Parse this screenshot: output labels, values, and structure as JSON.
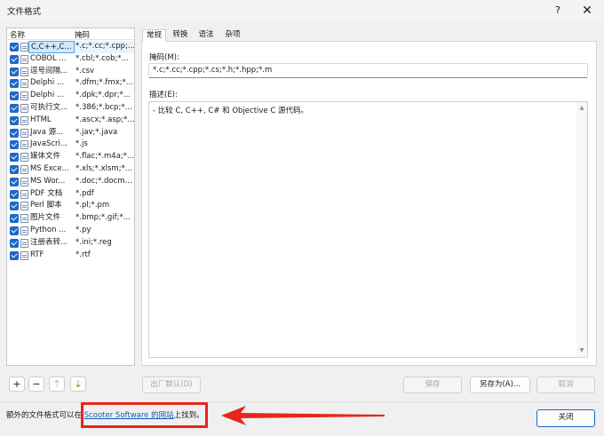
{
  "window": {
    "title": "文件格式",
    "help": "?",
    "close_glyph": "✕"
  },
  "list": {
    "headers": {
      "name": "名称",
      "mask": "掩码"
    },
    "rows": [
      {
        "name": "C,C++,C...",
        "mask": "*.c;*.cc;*.cpp;...",
        "selected": true
      },
      {
        "name": "COBOL ...",
        "mask": "*.cbl;*.cob;*..."
      },
      {
        "name": "逗号间隔...",
        "mask": "*.csv"
      },
      {
        "name": "Delphi ...",
        "mask": "*.dfm;*.fmx;*..."
      },
      {
        "name": "Delphi ...",
        "mask": "*.dpk;*.dpr;*..."
      },
      {
        "name": "可执行文...",
        "mask": "*.386;*.bcp;*..."
      },
      {
        "name": "HTML",
        "mask": "*.ascx;*.asp;*..."
      },
      {
        "name": "Java 源...",
        "mask": "*.jav;*.java"
      },
      {
        "name": "JavaScri...",
        "mask": "*.js"
      },
      {
        "name": "媒体文件",
        "mask": "*.flac;*.m4a;*..."
      },
      {
        "name": "MS Exce...",
        "mask": "*.xls;*.xlsm;*..."
      },
      {
        "name": "MS Wor...",
        "mask": "*.doc;*.docm..."
      },
      {
        "name": "PDF 文档",
        "mask": "*.pdf"
      },
      {
        "name": "Perl 脚本",
        "mask": "*.pl;*.pm"
      },
      {
        "name": "图片文件",
        "mask": "*.bmp;*.gif;*..."
      },
      {
        "name": "Python ...",
        "mask": "*.py"
      },
      {
        "name": "注册表转...",
        "mask": "*.ini;*.reg"
      },
      {
        "name": "RTF",
        "mask": "*.rtf"
      }
    ]
  },
  "list_buttons": {
    "add": "+",
    "remove": "−",
    "up": "⇡",
    "down": "⇣"
  },
  "tabs": [
    "常规",
    "转换",
    "语法",
    "杂项"
  ],
  "general": {
    "mask_label": "掩码(M):",
    "mask_value": "*.c;*.cc;*.cpp;*.cs;*.h;*.hpp;*.m",
    "desc_label": "描述(E):",
    "desc_value": "- 比较 C, C++, C# 和 Objective C 源代码。"
  },
  "buttons": {
    "export_defaults": "出厂默认(D)",
    "save": "保存",
    "save_as": "另存为(A)...",
    "cancel": "取消",
    "close": "关闭"
  },
  "footer": {
    "text_before": "额外的文件格式可以在 ",
    "link": "Scooter Software 的网站",
    "text_after": "上找到。"
  },
  "colors": {
    "annotation": "#e8261b",
    "accent": "#1c68c7",
    "link": "#0b5cb8"
  }
}
